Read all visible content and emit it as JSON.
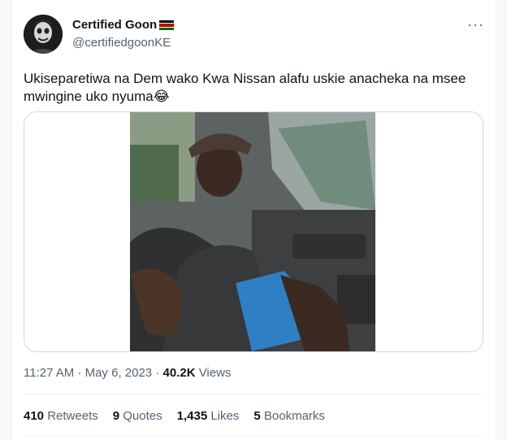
{
  "author": {
    "name": "Certified Goon",
    "handle": "@certifiedgoonKE",
    "flag_icon": "kenya-flag-icon"
  },
  "more_label": "···",
  "tweet_text": "Ukiseparetiwa na Dem wako Kwa Nissan alafu uskie anacheka na msee mwingine uko nyuma😂",
  "timestamp": "11:27 AM · May 6, 2023",
  "dot": "·",
  "views": {
    "count": "40.2K",
    "label": "Views"
  },
  "stats": {
    "retweets": {
      "count": "410",
      "label": "Retweets"
    },
    "quotes": {
      "count": "9",
      "label": "Quotes"
    },
    "likes": {
      "count": "1,435",
      "label": "Likes"
    },
    "bookmarks": {
      "count": "5",
      "label": "Bookmarks"
    }
  },
  "colors": {
    "text_primary": "#0f1419",
    "text_secondary": "#536471",
    "border": "#cfd9de"
  }
}
